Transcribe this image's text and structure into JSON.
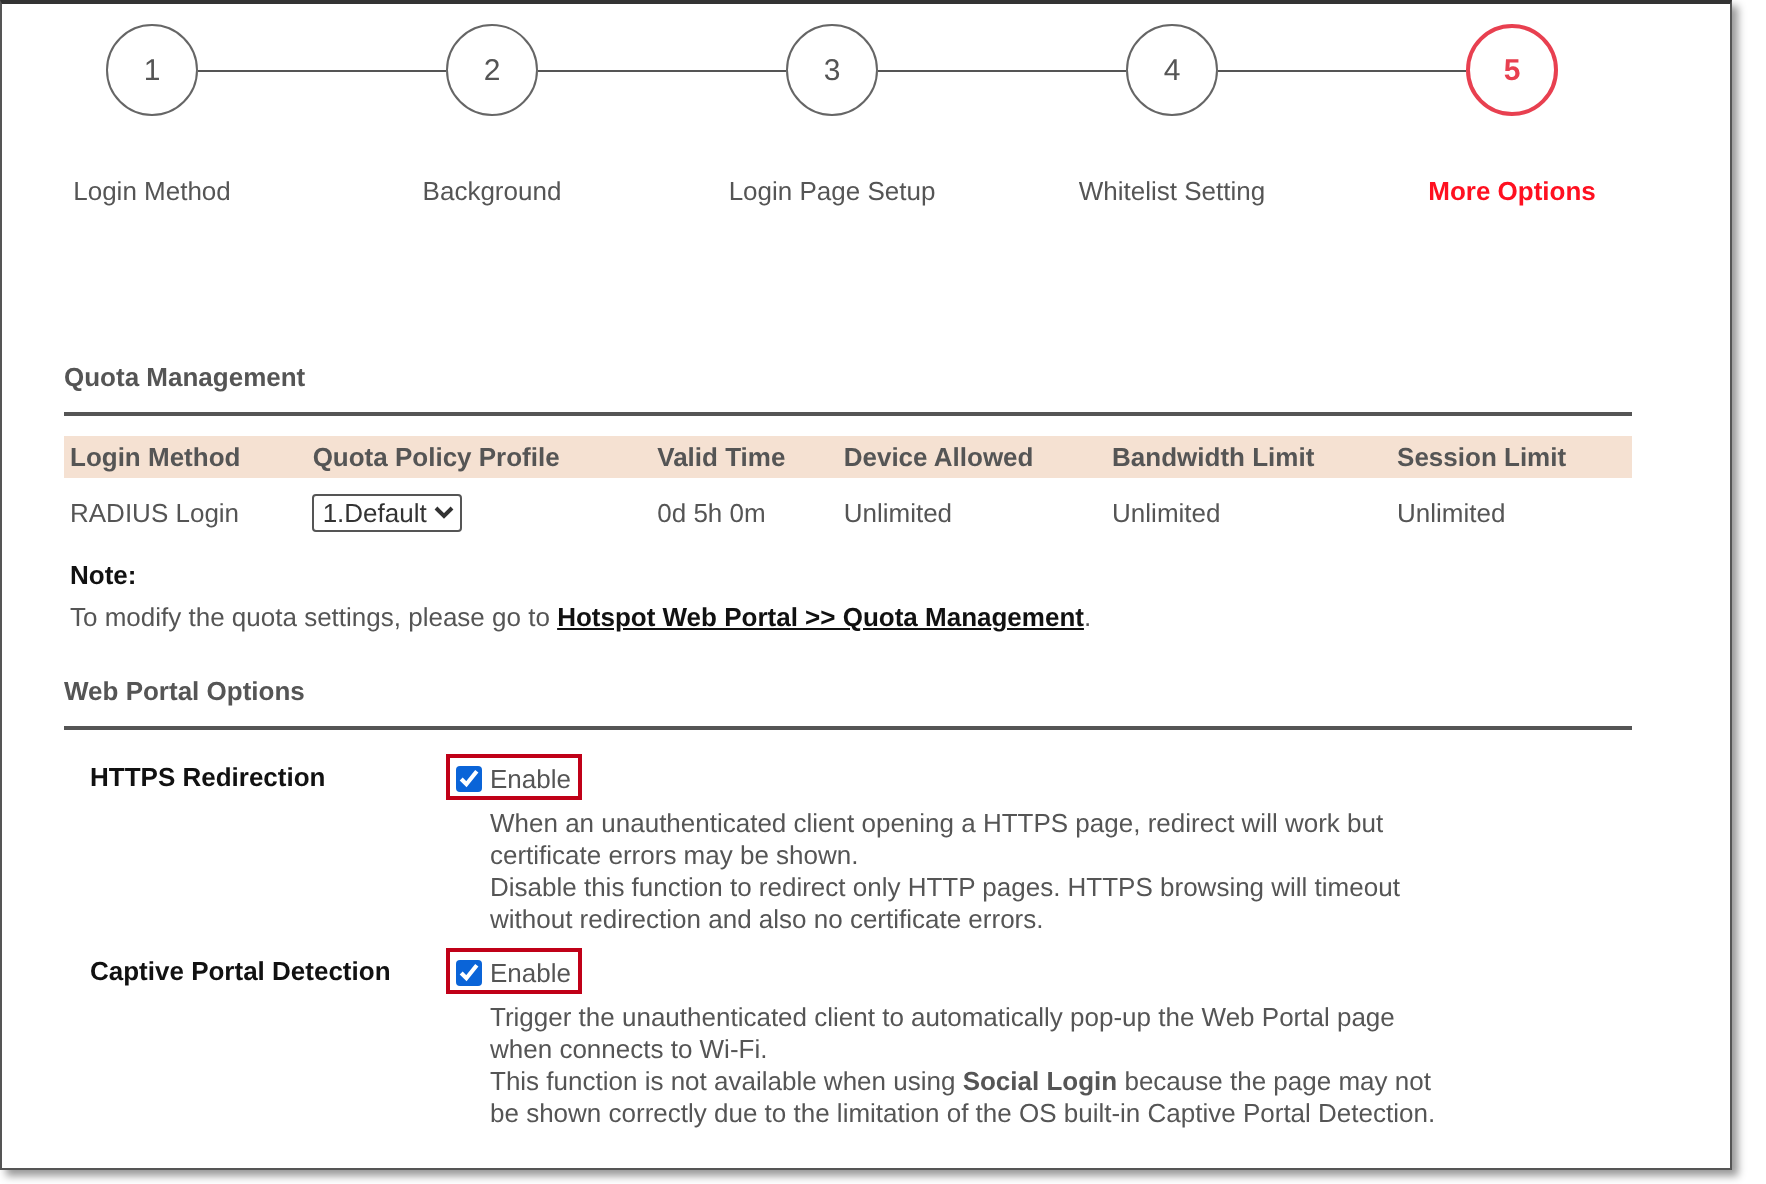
{
  "steps": [
    {
      "number": "1",
      "label": "Login Method",
      "selected": false
    },
    {
      "number": "2",
      "label": "Background",
      "selected": false
    },
    {
      "number": "3",
      "label": "Login Page Setup",
      "selected": false
    },
    {
      "number": "4",
      "label": "Whitelist Setting",
      "selected": false
    },
    {
      "number": "5",
      "label": "More Options",
      "selected": true
    }
  ],
  "quota": {
    "title": "Quota Management",
    "columns": [
      "Login Method",
      "Quota Policy Profile",
      "Valid Time",
      "Device Allowed",
      "Bandwidth Limit",
      "Session Limit"
    ],
    "row": {
      "login_method": "RADIUS Login",
      "profile": "1.Default",
      "valid_time": "0d 5h 0m",
      "device_allowed": "Unlimited",
      "bandwidth_limit": "Unlimited",
      "session_limit": "Unlimited"
    },
    "note_title": "Note:",
    "note_text": "To modify the quota settings, please go to",
    "note_link": "Hotspot Web Portal >> Quota Management",
    "note_end": "."
  },
  "options": {
    "title": "Web Portal Options",
    "items": [
      {
        "label": "HTTPS Redirection",
        "checkbox": "Enable",
        "checked": true,
        "paragraphs": [
          "When an unauthenticated client opening a HTTPS page, redirect will work but certificate errors may be shown.",
          "Disable this function to redirect only HTTP pages. HTTPS browsing will timeout without redirection and also no certificate errors."
        ]
      },
      {
        "label": "Captive Portal Detection",
        "checkbox": "Enable",
        "checked": true,
        "paragraphs": [
          "Trigger the unauthenticated client to automatically pop-up the Web Portal page when connects to Wi-Fi.",
          "This function is not available when using **Social Login** because the page may not be shown correctly due to the limitation of the OS built-in Captive Portal Detection."
        ]
      }
    ]
  }
}
